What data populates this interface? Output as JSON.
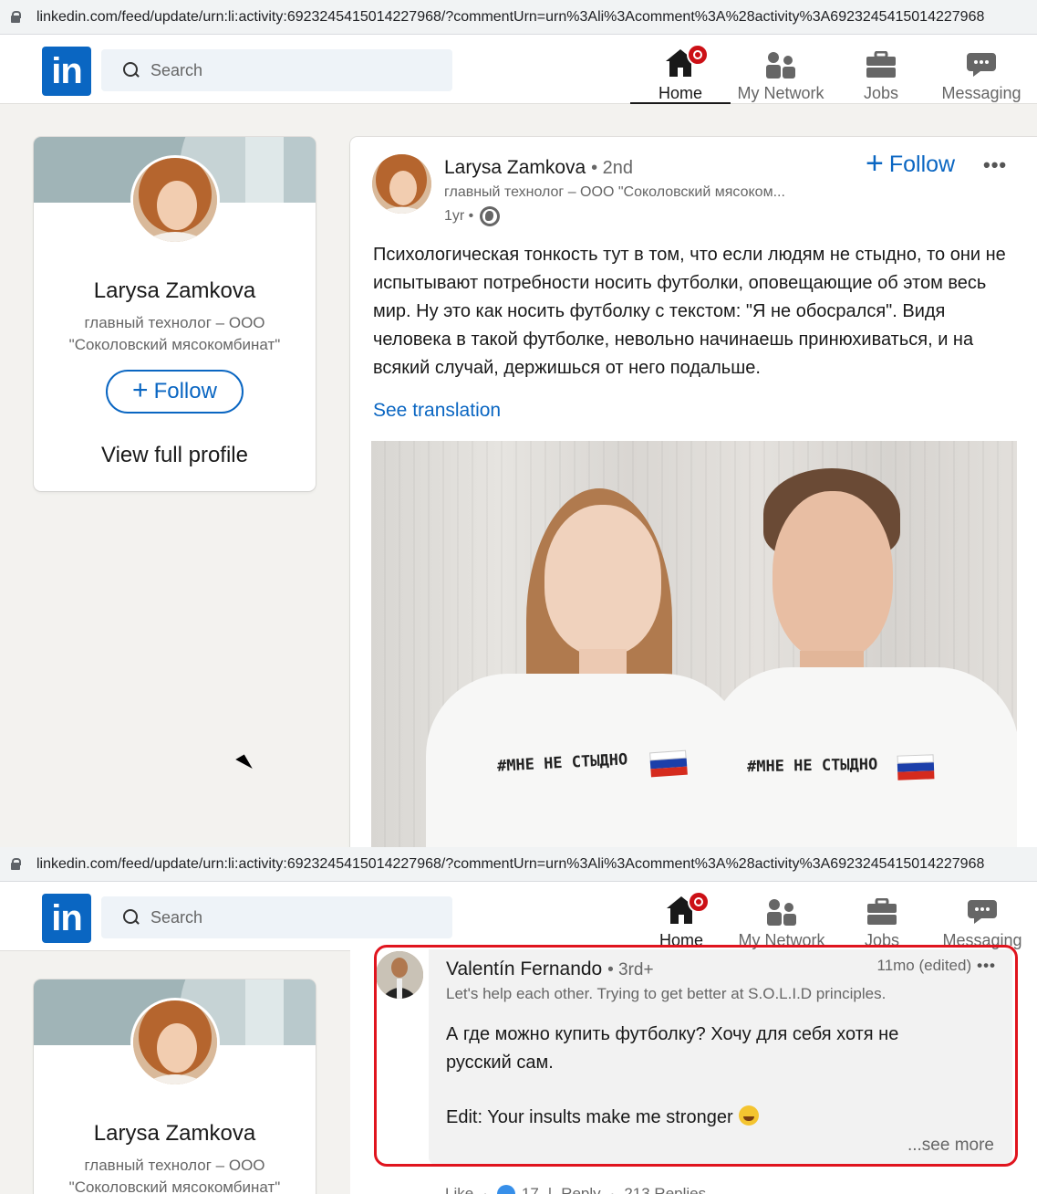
{
  "browser": {
    "url": "linkedin.com/feed/update/urn:li:activity:6923245415014227968/?commentUrn=urn%3Ali%3Acomment%3A%28activity%3A6923245415014227968"
  },
  "navbar": {
    "logo_text": "in",
    "search_placeholder": "Search",
    "items": [
      {
        "label": "Home",
        "icon": "home-icon"
      },
      {
        "label": "My Network",
        "icon": "network-icon"
      },
      {
        "label": "Jobs",
        "icon": "briefcase-icon"
      },
      {
        "label": "Messaging",
        "icon": "messaging-icon"
      }
    ],
    "brand_color": "#0a66c2"
  },
  "profile_card": {
    "name": "Larysa Zamkova",
    "headline": "главный технолог – ООО \"Соколовский мясокомбинат\"",
    "follow_label": "Follow",
    "view_profile_label": "View full profile"
  },
  "post": {
    "author": "Larysa Zamkova",
    "degree": "• 2nd",
    "headline": "главный технолог – ООО \"Соколовский мясоком...",
    "time": "1yr •",
    "follow_label": "Follow",
    "more": "•••",
    "text": "Психологическая тонкость тут в том, что если людям не стыдно, то они не испытывают потребности носить футболки, оповещающие об этом весь мир. Ну это как носить футболку с текстом: \"Я не обосрался\". Видя человека в такой футболке, невольно начинаешь принюхиваться, и на всякий случай, держишься от него подальше.",
    "see_translation": "See translation",
    "image_text_left": "#МНЕ НЕ СТЫДНО",
    "image_text_right": "#МНЕ НЕ СТЫДНО"
  },
  "comment": {
    "author": "Valentín Fernando",
    "degree": "• 3rd+",
    "time": "11mo (edited)",
    "more": "•••",
    "headline": "Let's help each other. Trying to get better at S.O.L.I.D principles.",
    "text": "А где можно купить футболку? Хочу для себя хотя не русский сам.",
    "edit": "Edit: Your insults make me stronger",
    "see_more": "...see more",
    "like_label": "Like",
    "like_count": "17",
    "reply_label": "Reply",
    "replies": "213 Replies",
    "highlight_color": "#e0141e"
  }
}
